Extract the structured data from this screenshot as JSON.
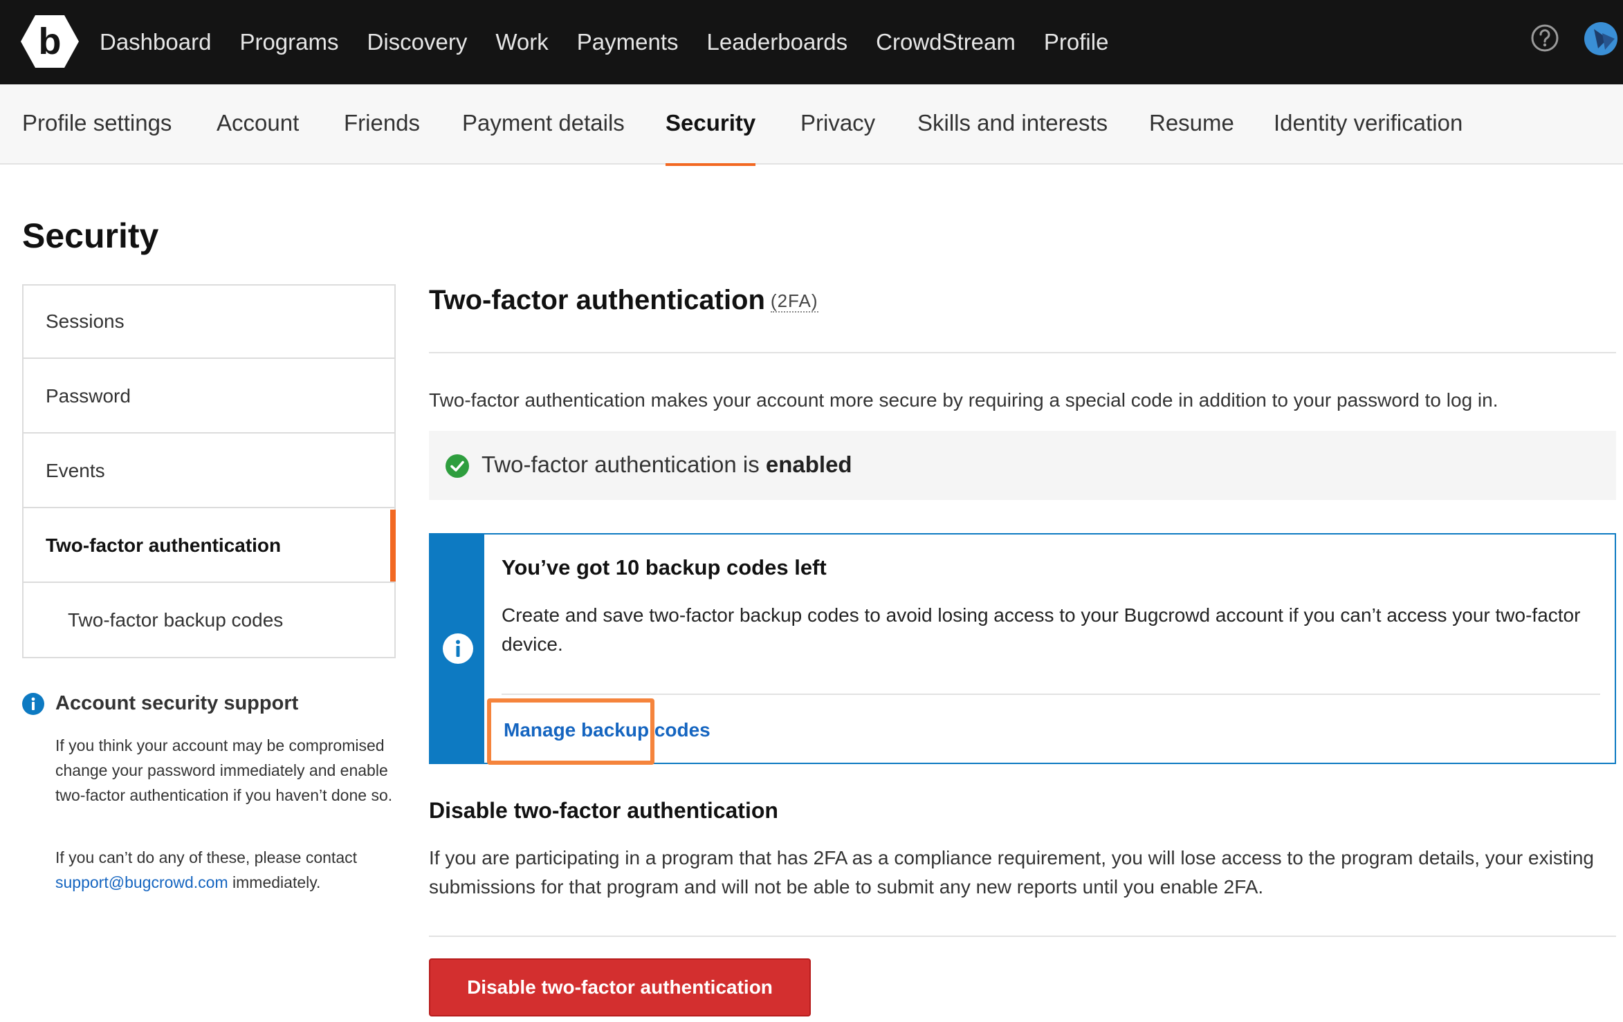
{
  "topnav": {
    "items": [
      "Dashboard",
      "Programs",
      "Discovery",
      "Work",
      "Payments",
      "Leaderboards",
      "CrowdStream",
      "Profile"
    ],
    "logo_letter": "b"
  },
  "settings_tabs": {
    "items": [
      "Profile settings",
      "Account",
      "Friends",
      "Payment details",
      "Security",
      "Privacy",
      "Skills and interests",
      "Resume",
      "Identity verification"
    ],
    "active": "Security"
  },
  "page": {
    "title": "Security"
  },
  "sidemenu": {
    "items": [
      "Sessions",
      "Password",
      "Events",
      "Two-factor authentication",
      "Two-factor backup codes"
    ],
    "active": "Two-factor authentication"
  },
  "support": {
    "title": "Account security support",
    "text1": "If you think your account may be compromised change your password immediately and enable two-factor authentication if you haven’t done so.",
    "text2_before": "If you can’t do any of these, please contact",
    "email": "support@bugcrowd.com",
    "text2_after": "immediately."
  },
  "main": {
    "title": "Two-factor authentication",
    "abbr": "(2FA)",
    "intro": "Two-factor authentication makes your account more secure by requiring a special code in addition to your password to log in.",
    "status_prefix": "Two-factor authentication is",
    "status_value": "enabled",
    "backup": {
      "title": "You’ve got 10 backup codes left",
      "text": "Create and save two-factor backup codes to avoid losing access to your Bugcrowd account if you can’t access your two-factor device.",
      "link": "Manage backup codes"
    },
    "disable": {
      "title": "Disable two-factor authentication",
      "text": "If you are participating in a program that has 2FA as a compliance requirement, you will lose access to the program details, your existing submissions for that program and will not be able to submit any new reports until you enable 2FA.",
      "button": "Disable two-factor authentication"
    }
  },
  "colors": {
    "accent_orange": "#f26822",
    "info_blue": "#0d7ac2",
    "link_blue": "#1565c0",
    "success_green": "#2e9e3e",
    "danger_red": "#d32f2f",
    "highlight_orange": "#f5843c"
  },
  "icons": {
    "logo": "bugcrowd-logo-icon",
    "help": "help-circle-icon",
    "avatar": "user-avatar-icon",
    "status": "check-circle-icon",
    "info": "info-circle-icon"
  }
}
